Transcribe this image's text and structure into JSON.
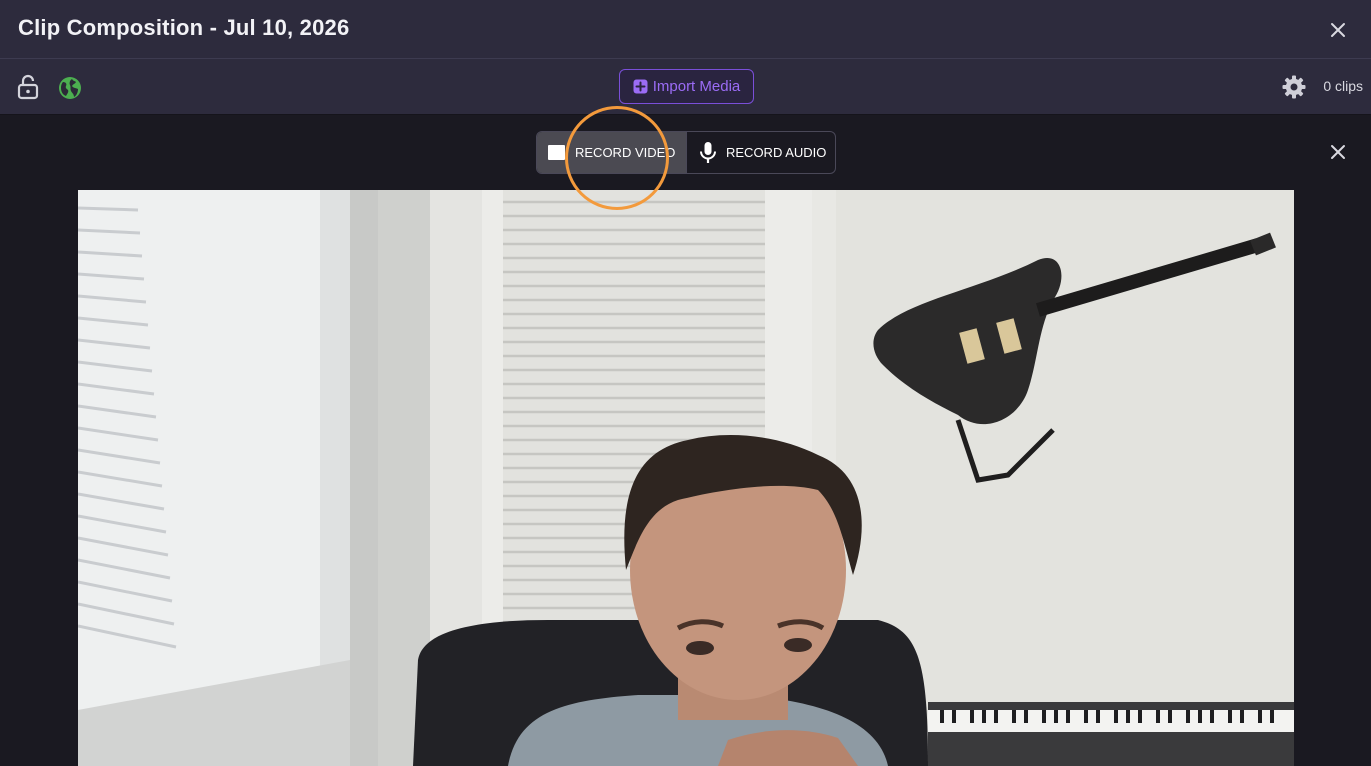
{
  "window": {
    "title": "Clip Composition - Jul 10, 2026",
    "close_icon": "close-icon"
  },
  "toolbar": {
    "lock_icon": "lock-open-icon",
    "globe_icon": "globe-icon",
    "globe_color": "#4caf50",
    "import_label": "Import Media",
    "import_icon": "plus-square-icon",
    "accent_color": "#9b6cf5",
    "settings_icon": "gear-icon",
    "clips_count": "0 clips"
  },
  "recorder": {
    "video_label": "RECORD VIDEO",
    "audio_label": "RECORD AUDIO",
    "video_icon": "camera-icon",
    "audio_icon": "microphone-icon",
    "selected": "RECORD VIDEO",
    "close_icon": "close-icon",
    "highlight_color": "#f39a3c"
  },
  "preview": {
    "type": "webcam-live-preview"
  }
}
